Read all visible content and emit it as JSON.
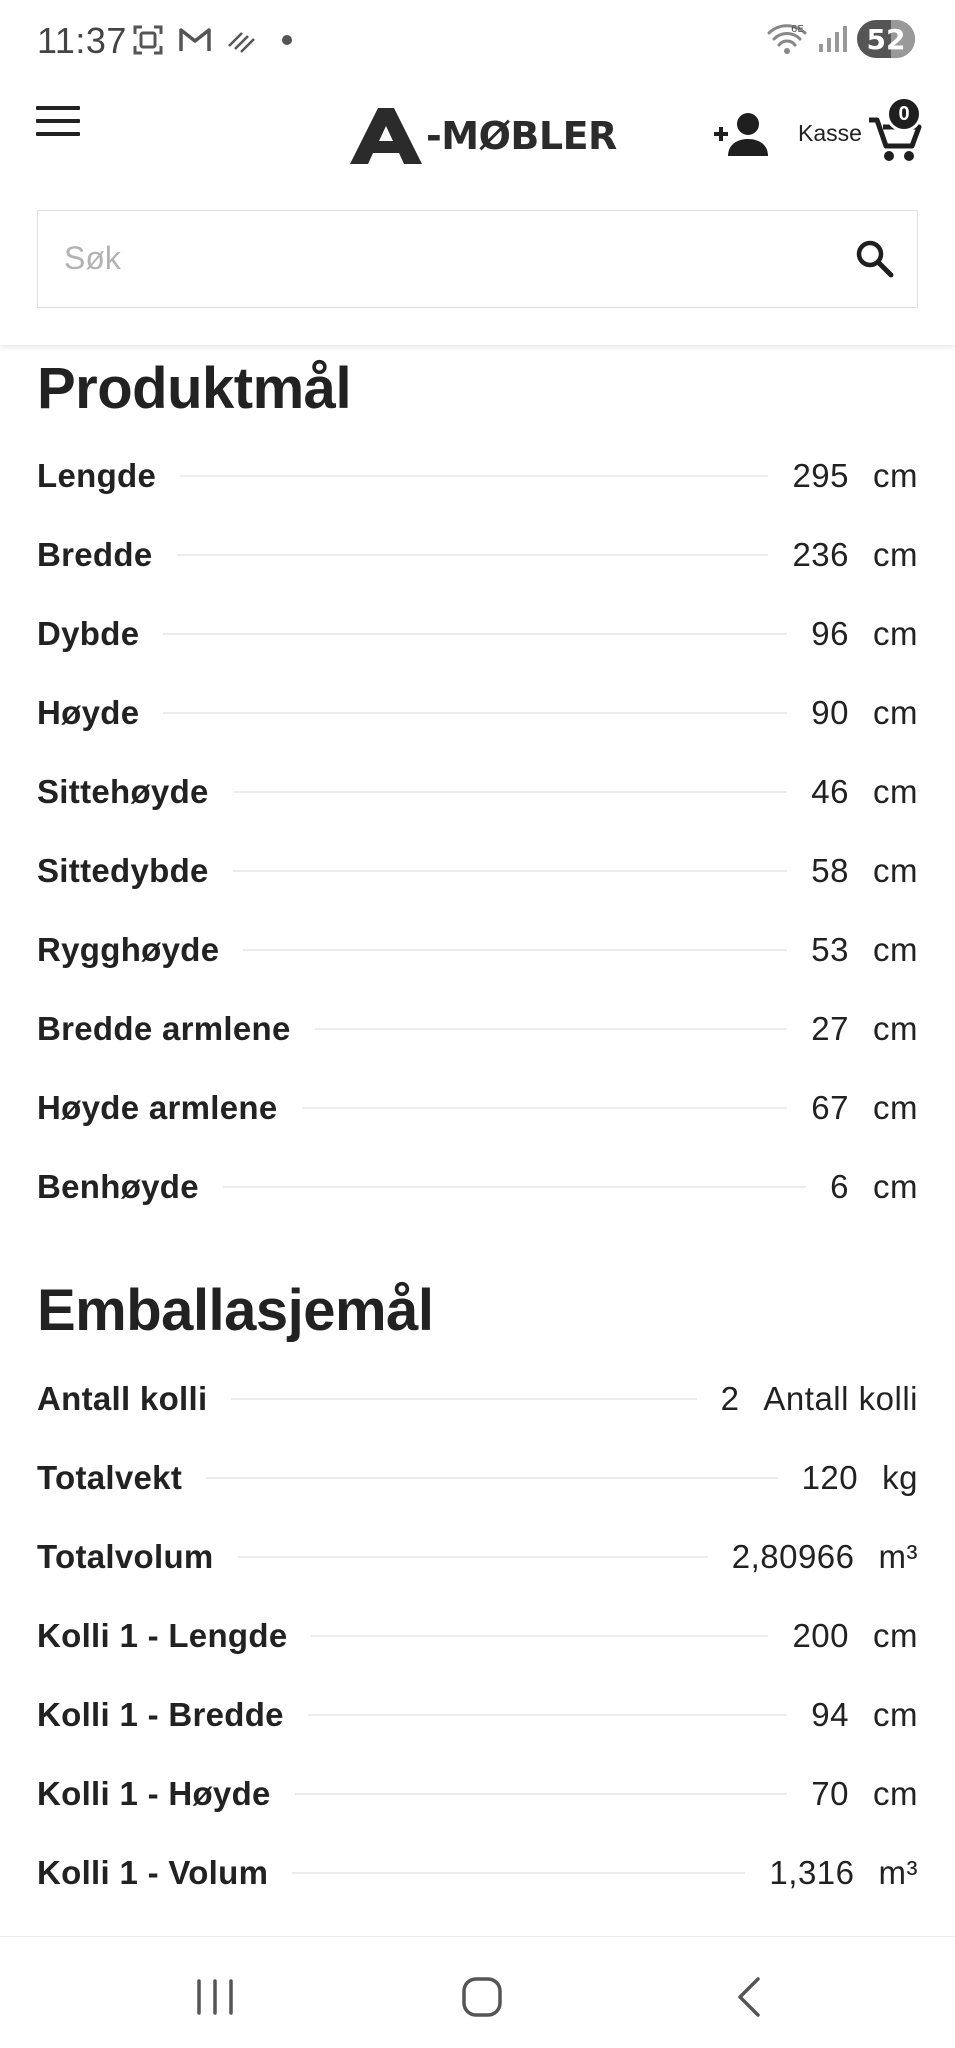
{
  "status_bar": {
    "time": "11:37",
    "battery": "52",
    "icons": [
      "screenshot-icon",
      "gmail-icon",
      "missed-call-icon",
      "notification-dot",
      "wifi-icon",
      "signal-icon",
      "battery-icon"
    ]
  },
  "header": {
    "logo_text": "-MØBLER",
    "kasse_label": "Kasse",
    "cart_count": "0"
  },
  "search": {
    "placeholder": "Søk"
  },
  "product_dimensions": {
    "title": "Produktmål",
    "rows": [
      {
        "label": "Lengde",
        "value": "295",
        "unit": "cm"
      },
      {
        "label": "Bredde",
        "value": "236",
        "unit": "cm"
      },
      {
        "label": "Dybde",
        "value": "96",
        "unit": "cm"
      },
      {
        "label": "Høyde",
        "value": "90",
        "unit": "cm"
      },
      {
        "label": "Sittehøyde",
        "value": "46",
        "unit": "cm"
      },
      {
        "label": "Sittedybde",
        "value": "58",
        "unit": "cm"
      },
      {
        "label": "Rygghøyde",
        "value": "53",
        "unit": "cm"
      },
      {
        "label": "Bredde armlene",
        "value": "27",
        "unit": "cm"
      },
      {
        "label": "Høyde armlene",
        "value": "67",
        "unit": "cm"
      },
      {
        "label": "Benhøyde",
        "value": "6",
        "unit": "cm"
      }
    ]
  },
  "packaging_dimensions": {
    "title": "Emballasjemål",
    "rows": [
      {
        "label": "Antall kolli",
        "value": "2",
        "unit": "Antall kolli"
      },
      {
        "label": "Totalvekt",
        "value": "120",
        "unit": "kg"
      },
      {
        "label": "Totalvolum",
        "value": "2,80966",
        "unit": "m³"
      },
      {
        "label": "Kolli 1 - Lengde",
        "value": "200",
        "unit": "cm"
      },
      {
        "label": "Kolli 1 - Bredde",
        "value": "94",
        "unit": "cm"
      },
      {
        "label": "Kolli 1 - Høyde",
        "value": "70",
        "unit": "cm"
      },
      {
        "label": "Kolli 1 - Volum",
        "value": "1,316",
        "unit": "m³"
      }
    ]
  },
  "navigation": {
    "buttons": [
      "recent-apps",
      "home",
      "back"
    ]
  }
}
